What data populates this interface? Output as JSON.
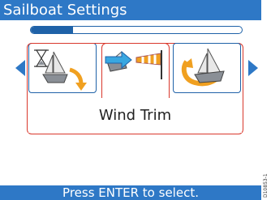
{
  "title": "Sailboat Settings",
  "progress": {
    "value": 0.2
  },
  "tiles": [
    {
      "name": "Timed Tack"
    },
    {
      "name": "Wind Trim"
    },
    {
      "name": "Tack Angle"
    }
  ],
  "selected": {
    "label": "Wind Trim",
    "index": 1
  },
  "footer": {
    "instruction": "Press ENTER to select."
  },
  "side_label": "D10853-1",
  "colors": {
    "accent": "#2e78c6",
    "accent_dark": "#1f62a8",
    "selection": "#d9382c",
    "sail": "#e8e8e8",
    "hull": "#8a8f96",
    "arrow_orange": "#f0a020"
  }
}
